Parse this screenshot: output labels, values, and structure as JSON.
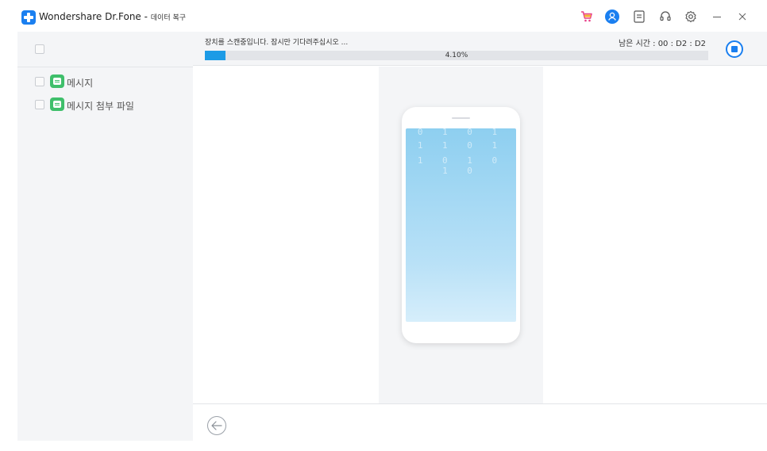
{
  "app": {
    "title": "Wondershare Dr.Fone - ",
    "subtitle": "데이터 복구"
  },
  "titlebar_icons": [
    "cart-icon",
    "account-icon",
    "feedback-icon",
    "support-icon",
    "settings-icon",
    "minimize-icon",
    "close-icon"
  ],
  "colors": {
    "accent": "#1a7ff0",
    "progress": "#1c9be6",
    "cart": "#e8418a",
    "message_icon": "#3fbf6b",
    "sidebar_bg": "#f4f5f7"
  },
  "sidebar": {
    "items": [
      {
        "label": "메시지",
        "icon": "message-icon"
      },
      {
        "label": "메시지 첨부 파일",
        "icon": "message-icon"
      }
    ]
  },
  "scan": {
    "status": "장치를 스캔중입니다. 잠시만 기다려주십시오 ...",
    "remaining": "남은 시간 : 00 : D2 : D2",
    "percent_label": "4.10%",
    "progress": 0.041
  },
  "phone": {
    "code_rows": [
      "0 1 0 1",
      "1 1 0 1",
      "1 0 1 0 1 0"
    ]
  }
}
